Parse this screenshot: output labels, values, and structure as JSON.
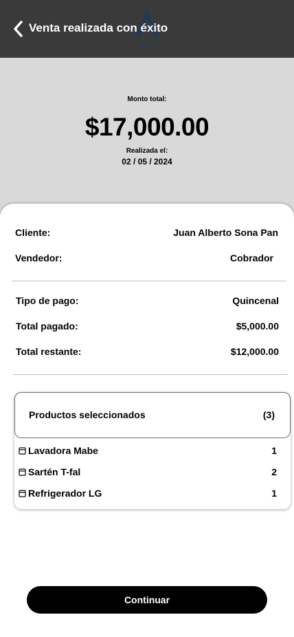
{
  "header": {
    "title": "Venta realizada con éxito",
    "logo_text": "SPECOMER"
  },
  "summary": {
    "monto_label": "Monto total:",
    "monto_value": "$17,000.00",
    "fecha_label": "Realizada el:",
    "fecha_value": "02 / 05 / 2024"
  },
  "details": {
    "cliente_label": "Cliente:",
    "cliente_value": "Juan Alberto Sona Pan",
    "vendedor_label": "Vendedor:",
    "vendedor_value": "Cobrador",
    "tipo_pago_label": "Tipo de pago:",
    "tipo_pago_value": "Quincenal",
    "total_pagado_label": "Total pagado:",
    "total_pagado_value": "$5,000.00",
    "total_restante_label": "Total restante:",
    "total_restante_value": "$12,000.00"
  },
  "products": {
    "title": "Productos seleccionados",
    "count": "(3)",
    "items": [
      {
        "name": "Lavadora Mabe",
        "qty": "1",
        "icon": "box-icon"
      },
      {
        "name": "Sartén T-fal",
        "qty": "2",
        "icon": "box-icon"
      },
      {
        "name": "Refrigerador LG",
        "qty": "1",
        "icon": "box-icon"
      }
    ]
  },
  "actions": {
    "continue_label": "Continuar"
  },
  "colors": {
    "header_bg": "#3a3a3a",
    "summary_bg": "#d9d9d9",
    "button_bg": "#000000",
    "logo_accent": "#1e3a5f"
  }
}
